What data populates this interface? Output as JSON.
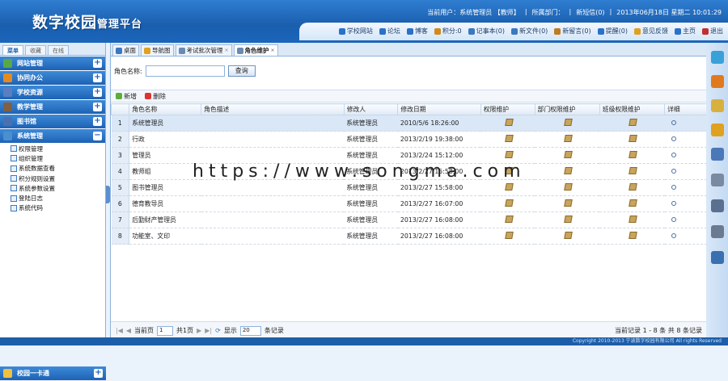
{
  "header": {
    "title": "数字校园",
    "subtitle": "管理平台",
    "current_user": "当前用户：系统管理员 【教师】",
    "dept": "所属部门：",
    "dept_sep": "|",
    "messages": "新短信(0)",
    "sep2": "|",
    "date": "2013年06月18日 星期二 10:01:29"
  },
  "header_links": [
    {
      "label": "学校网站",
      "color": "#2a72c9"
    },
    {
      "label": "论坛",
      "color": "#2a72c9"
    },
    {
      "label": "博客",
      "color": "#2a72c9"
    },
    {
      "label": "积分:0",
      "color": "#d08a1a"
    },
    {
      "label": "记事本(0)",
      "color": "#3a78c0"
    },
    {
      "label": "新文件(0)",
      "color": "#3a78c0"
    },
    {
      "label": "新留言(0)",
      "color": "#c07a20"
    },
    {
      "label": "提醒(0)",
      "color": "#2a72c9"
    },
    {
      "label": "意见反馈",
      "color": "#e0a020"
    },
    {
      "label": "主页",
      "color": "#2a72c9"
    },
    {
      "label": "退出",
      "color": "#c03030"
    }
  ],
  "sidebar": {
    "tabs": [
      "菜单",
      "收藏",
      "在线"
    ],
    "groups": [
      {
        "label": "网站管理",
        "icon": "globe-icon",
        "color": "#58a848",
        "sign": "+"
      },
      {
        "label": "协同办公",
        "icon": "rss-icon",
        "color": "#e58a20",
        "sign": "+"
      },
      {
        "label": "学校资源",
        "icon": "books-icon",
        "color": "#5a7fc0",
        "sign": "+"
      },
      {
        "label": "教学管理",
        "icon": "teacher-icon",
        "color": "#806040",
        "sign": "+"
      },
      {
        "label": "图书馆",
        "icon": "library-icon",
        "color": "#4a70b0",
        "sign": "+"
      },
      {
        "label": "系统管理",
        "icon": "settings-icon",
        "color": "#4a90d0",
        "sign": "−"
      }
    ],
    "subitems": [
      "权限管理",
      "组织管理",
      "系统数据查看",
      "积分规则设置",
      "系统参数设置",
      "登陆日志",
      "系统代码"
    ],
    "bottom": {
      "label": "校园一卡通",
      "sign": "+"
    }
  },
  "tabs": [
    {
      "label": "桌面"
    },
    {
      "label": "导航图"
    },
    {
      "label": "考试批次管理",
      "close": "×"
    },
    {
      "label": "角色维护",
      "close": "×"
    }
  ],
  "search": {
    "label": "角色名称:",
    "value": "",
    "button": "查询"
  },
  "toolbar": {
    "add": "新增",
    "delete": "删除"
  },
  "table": {
    "headers": [
      "",
      "角色名称",
      "角色描述",
      "修改人",
      "修改日期",
      "权限维护",
      "部门权限维护",
      "班级权限维护",
      "详细"
    ],
    "rows": [
      {
        "n": "1",
        "name": "系统管理员",
        "desc": "",
        "by": "系统管理员",
        "date": "2010/5/6 18:26:00"
      },
      {
        "n": "2",
        "name": "行政",
        "desc": "",
        "by": "系统管理员",
        "date": "2013/2/19 19:38:00"
      },
      {
        "n": "3",
        "name": "管理员",
        "desc": "",
        "by": "系统管理员",
        "date": "2013/2/24 15:12:00"
      },
      {
        "n": "4",
        "name": "教师组",
        "desc": "",
        "by": "系统管理员",
        "date": "2013/2/27 15:58:00"
      },
      {
        "n": "5",
        "name": "图书管理员",
        "desc": "",
        "by": "系统管理员",
        "date": "2013/2/27 15:58:00"
      },
      {
        "n": "6",
        "name": "德育教导员",
        "desc": "",
        "by": "系统管理员",
        "date": "2013/2/27 16:07:00"
      },
      {
        "n": "7",
        "name": "后勤财产管理员",
        "desc": "",
        "by": "系统管理员",
        "date": "2013/2/27 16:08:00"
      },
      {
        "n": "8",
        "name": "功能室、文印",
        "desc": "",
        "by": "系统管理员",
        "date": "2013/2/27 16:08:00"
      }
    ]
  },
  "pager": {
    "page_label": "当前页",
    "page": "1",
    "total": "共1页",
    "show": "显示",
    "size": "20",
    "per": "条记录",
    "summary": "当前记录 1 - 8 条 共 8 条记录"
  },
  "watermark": "https://www.songma.com",
  "footer": "Copyright 2010-2013 宁波数字校园有限公司 All rights Reserved"
}
